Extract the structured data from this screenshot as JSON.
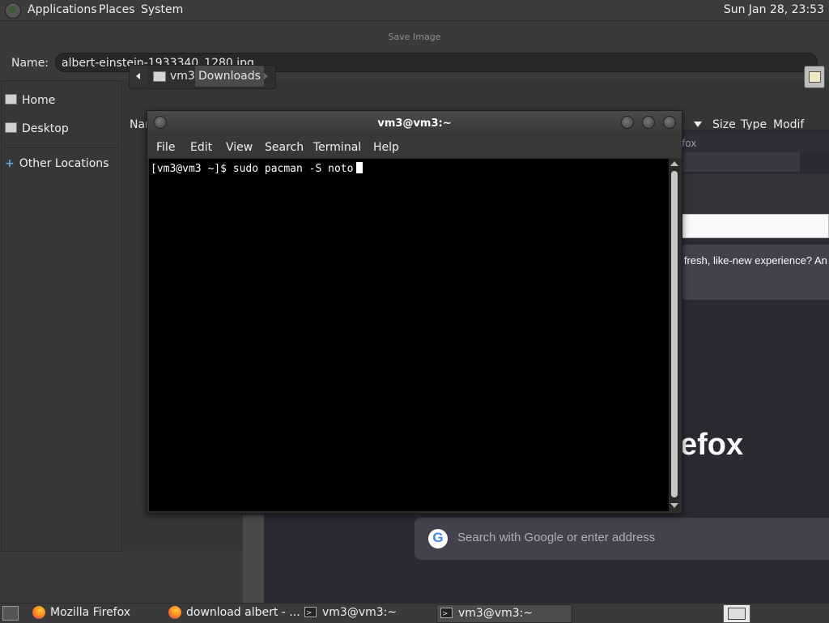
{
  "top_panel": {
    "menus": [
      "Applications",
      "Places",
      "System"
    ],
    "clock": "Sun Jan 28, 23:53"
  },
  "save_dialog": {
    "title": "Save Image",
    "name_label": "Name:",
    "name_value": "albert-einstein-1933340_1280.jpg",
    "places": [
      "Home",
      "Desktop",
      "Other Locations"
    ],
    "path": [
      "vm3",
      "Downloads"
    ],
    "columns": [
      "Nar",
      "Size",
      "Type",
      "Modif"
    ]
  },
  "firefox": {
    "tab_text": "fox",
    "banner_text": "a fresh, like-new experience? An",
    "wordmark": "efox",
    "search_placeholder": "Search with Google or enter address",
    "google_glyph": "G"
  },
  "terminal": {
    "title": "vm3@vm3:~",
    "menus": [
      "File",
      "Edit",
      "View",
      "Search",
      "Terminal",
      "Help"
    ],
    "prompt_line": "[vm3@vm3 ~]$ sudo pacman -S noto"
  },
  "taskbar": {
    "tasks": [
      "Mozilla Firefox",
      "download albert - ...",
      "vm3@vm3:~",
      "vm3@vm3:~"
    ]
  },
  "icons": {
    "app_logo": "gnome-foot-icon",
    "place": "folder-icon",
    "other_locations": "plus-icon",
    "firefox": "firefox-icon",
    "terminal": "terminal-icon"
  }
}
